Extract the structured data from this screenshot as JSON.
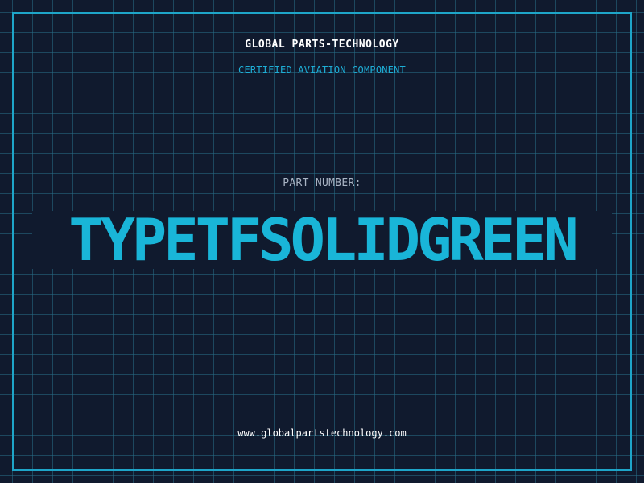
{
  "company_name": "GLOBAL PARTS-TECHNOLOGY",
  "tagline": "CERTIFIED AVIATION COMPONENT",
  "part_number_label": "PART NUMBER:",
  "part_number": "TYPETFSOLIDGREEN",
  "website": "www.globalpartstechnology.com",
  "colors": {
    "background": "#101a2e",
    "accent": "#1ea5c9",
    "grid": "#286e87",
    "part_number": "#19b5d8",
    "label": "#a9b4c4",
    "text": "#ffffff"
  }
}
